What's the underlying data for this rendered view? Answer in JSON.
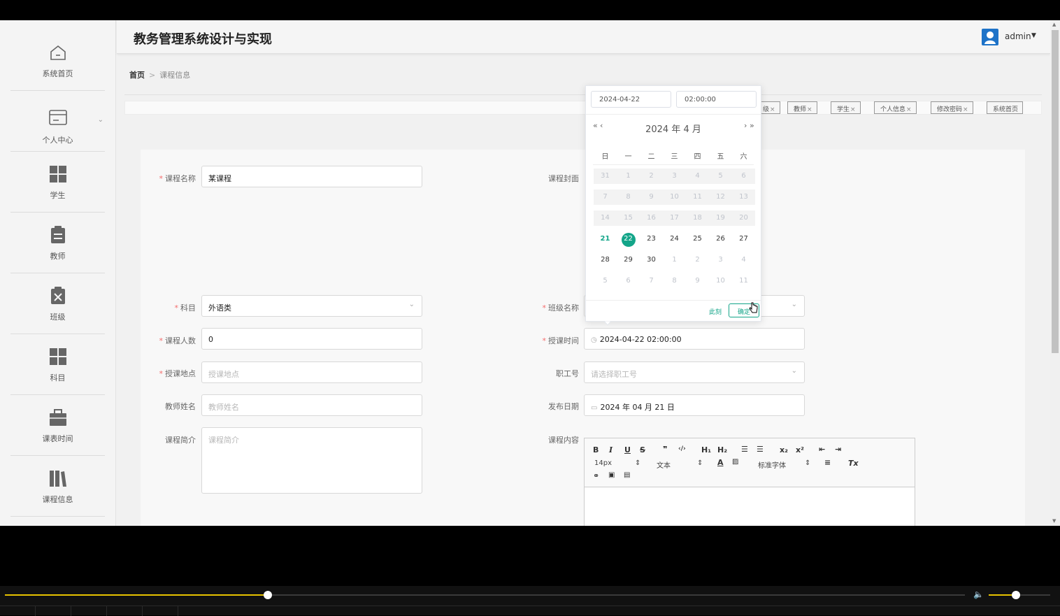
{
  "header": {
    "title": "教务管理系统设计与实现",
    "user": "admin"
  },
  "sidebar": {
    "items": [
      {
        "label": "系统首页",
        "icon": "home-icon"
      },
      {
        "label": "个人中心",
        "icon": "card-icon"
      },
      {
        "label": "学生",
        "icon": "grid-icon"
      },
      {
        "label": "教师",
        "icon": "clipboard-icon"
      },
      {
        "label": "班级",
        "icon": "clipboard-x-icon"
      },
      {
        "label": "科目",
        "icon": "grid-icon"
      },
      {
        "label": "课表时间",
        "icon": "briefcase-icon"
      },
      {
        "label": "课程信息",
        "icon": "books-icon"
      }
    ]
  },
  "breadcrumb": {
    "home": "首页",
    "separator": ">",
    "current": "课程信息"
  },
  "tags": [
    {
      "label": "级"
    },
    {
      "label": "教师"
    },
    {
      "label": "学生"
    },
    {
      "label": "个人信息"
    },
    {
      "label": "修改密码"
    },
    {
      "label": "系统首页"
    }
  ],
  "form": {
    "course_name": {
      "label": "课程名称",
      "value": "某课程"
    },
    "course_cover": {
      "label": "课程封面"
    },
    "subject": {
      "label": "科目",
      "value": "外语类"
    },
    "class_name": {
      "label": "班级名称"
    },
    "course_count": {
      "label": "课程人数",
      "value": "0"
    },
    "teach_time": {
      "label": "授课时间",
      "value": "2024-04-22 02:00:00"
    },
    "teach_place": {
      "label": "授课地点",
      "placeholder": "授课地点"
    },
    "staff_no": {
      "label": "职工号",
      "placeholder": "请选择职工号"
    },
    "teacher_name": {
      "label": "教师姓名",
      "placeholder": "教师姓名"
    },
    "publish_date": {
      "label": "发布日期",
      "value": "2024 年 04 月 21 日"
    },
    "course_intro": {
      "label": "课程简介",
      "placeholder": "课程简介"
    },
    "course_content": {
      "label": "课程内容"
    }
  },
  "editor": {
    "font_size": "14px",
    "paragraph": "文本",
    "font_family": "标准字体",
    "buttons": [
      "B",
      "I",
      "U",
      "S",
      "❞",
      "‹/›",
      "H₁",
      "H₂",
      "x₂",
      "x²",
      "Tx"
    ]
  },
  "datepicker": {
    "date_input": "2024-04-22",
    "time_input": "02:00:00",
    "year_month": "2024 年  4 月",
    "prev_year": "«",
    "prev_month": "‹",
    "next_month": "›",
    "next_year": "»",
    "weekdays": [
      "日",
      "一",
      "二",
      "三",
      "四",
      "五",
      "六"
    ],
    "weeks": [
      [
        "31",
        "1",
        "2",
        "3",
        "4",
        "5",
        "6"
      ],
      [
        "7",
        "8",
        "9",
        "10",
        "11",
        "12",
        "13"
      ],
      [
        "14",
        "15",
        "16",
        "17",
        "18",
        "19",
        "20"
      ],
      [
        "21",
        "22",
        "23",
        "24",
        "25",
        "26",
        "27"
      ],
      [
        "28",
        "29",
        "30",
        "1",
        "2",
        "3",
        "4"
      ],
      [
        "5",
        "6",
        "7",
        "8",
        "9",
        "10",
        "11"
      ]
    ],
    "today": "21",
    "selected": "22",
    "now_label": "此刻",
    "confirm_label": "确定"
  },
  "player": {
    "progress": 0.274,
    "volume": 0.44
  },
  "colors": {
    "accent": "#13a589",
    "required": "#f56c6c",
    "progress": "#e6c200"
  }
}
